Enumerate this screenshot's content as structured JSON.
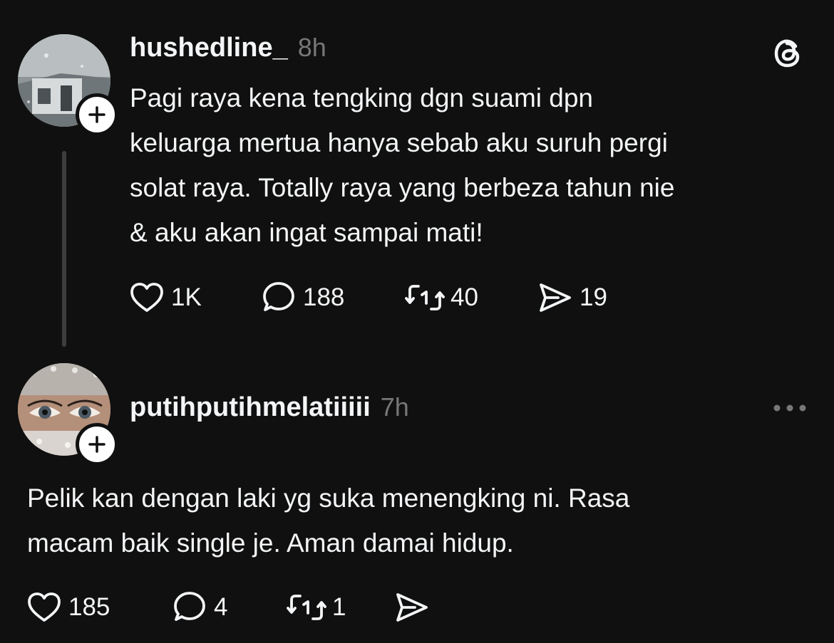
{
  "post": {
    "username": "hushedline_",
    "timestamp": "8h",
    "text": "Pagi raya kena tengking dgn suami dpn keluarga mertua hanya sebab aku suruh pergi solat raya. Totally raya yang berbeza tahun nie & aku akan ingat sampai mati!",
    "lines": [
      "Pagi raya kena tengking dgn suami dpn",
      "keluarga mertua hanya sebab aku suruh pergi",
      "solat raya. Totally raya yang berbeza tahun nie",
      "& aku akan ingat sampai mati!"
    ],
    "likes": "1K",
    "replies": "188",
    "reposts": "40",
    "shares": "19",
    "corner_icon": "threads-logo-icon"
  },
  "reply": {
    "username": "putihputihmelatiiiii",
    "timestamp": "7h",
    "lines": [
      "Pelik kan dengan laki yg suka menengking ni. Rasa",
      "macam baik single je. Aman damai hidup."
    ],
    "likes": "185",
    "replies": "4",
    "reposts": "1",
    "shares": "",
    "corner_icon": "more-options-icon"
  },
  "colors": {
    "background": "#101010",
    "text": "#f3f5f7",
    "muted": "#777777",
    "thread_line": "#3d3d3d"
  }
}
